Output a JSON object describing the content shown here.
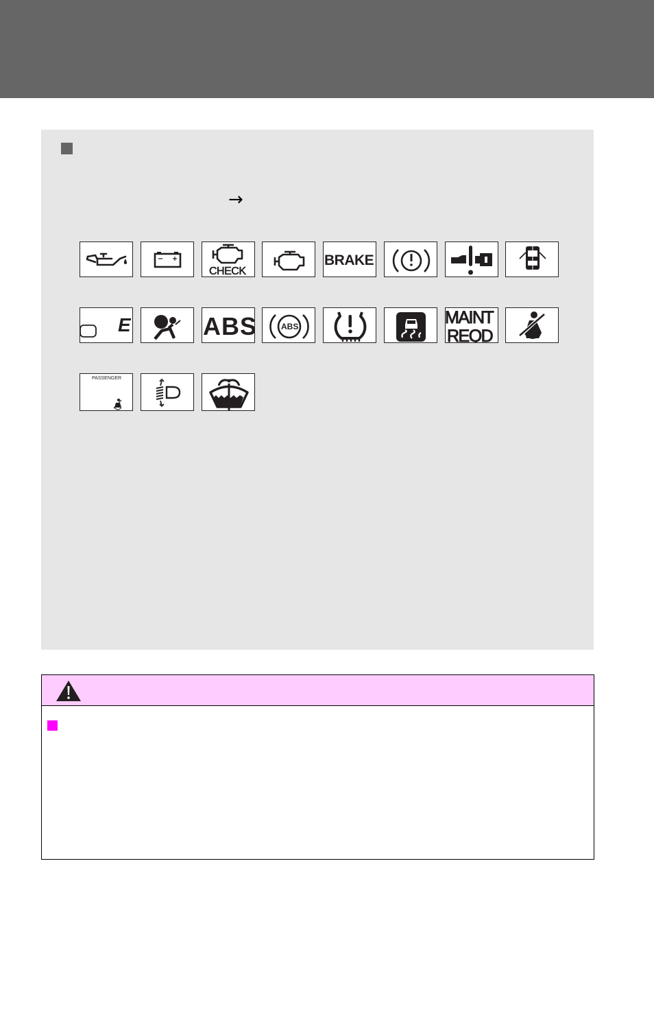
{
  "header": {
    "band_color": "#666666"
  },
  "info_panel": {
    "background": "#e6e6e6",
    "bullet_icon": "square-bullet-icon",
    "arrow": "→"
  },
  "warning_lights": {
    "rows": [
      [
        {
          "name": "oil-pressure-warning-icon"
        },
        {
          "name": "charging-system-warning-icon",
          "minus": "−",
          "plus": "+"
        },
        {
          "name": "check-engine-icon",
          "label": "CHECK"
        },
        {
          "name": "malfunction-indicator-icon"
        },
        {
          "name": "brake-system-warning-icon",
          "label": "BRAKE"
        },
        {
          "name": "brake-warning-circle-icon"
        },
        {
          "name": "power-steering-warning-icon"
        },
        {
          "name": "open-door-warning-icon"
        }
      ],
      [
        {
          "name": "low-fuel-warning-icon",
          "label": "E"
        },
        {
          "name": "srs-airbag-warning-icon"
        },
        {
          "name": "abs-warning-text-icon",
          "label": "ABS"
        },
        {
          "name": "abs-warning-circle-icon",
          "label": "ABS"
        },
        {
          "name": "tire-pressure-warning-icon"
        },
        {
          "name": "slip-indicator-icon"
        },
        {
          "name": "maintenance-required-icon",
          "label_line1": "MAINT",
          "label_line2": "REQD"
        },
        {
          "name": "driver-seatbelt-reminder-icon"
        }
      ],
      [
        {
          "name": "passenger-seatbelt-reminder-icon",
          "label": "PASSENGER"
        },
        {
          "name": "headlight-leveling-icon"
        },
        {
          "name": "low-washer-fluid-icon"
        }
      ]
    ]
  },
  "caution": {
    "header_color": "#ffccff",
    "warning_icon": "warning-triangle-icon",
    "bullet_color": "#ff00ff"
  }
}
